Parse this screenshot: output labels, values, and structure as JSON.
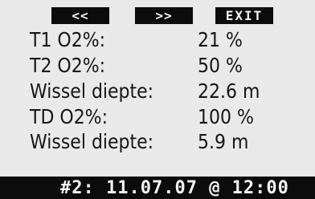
{
  "softkeys": {
    "back_label": "<<",
    "forward_label": ">>",
    "exit_label": "EXIT"
  },
  "gas_list": [
    {
      "label": "T1 O2%:",
      "value": "21 %"
    },
    {
      "label": "T2 O2%:",
      "value": "50 %"
    },
    {
      "label": "Wissel diepte:",
      "value": "22.6 m"
    },
    {
      "label": "TD O2%:",
      "value": "100 %"
    },
    {
      "label": "Wissel diepte:",
      "value": "5.9 m"
    }
  ],
  "footer": {
    "dive_info": "#2: 11.07.07 @ 12:00"
  }
}
